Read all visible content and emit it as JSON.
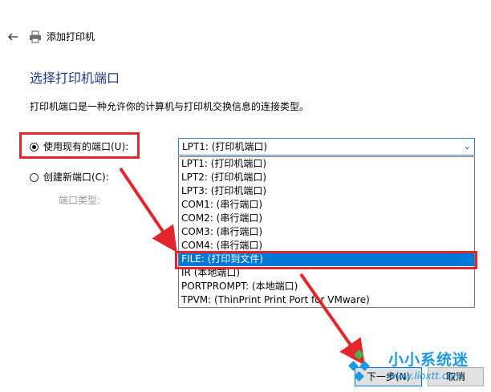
{
  "header": {
    "title": "添加打印机",
    "back_icon": "back-arrow-icon",
    "printer_icon": "printer-icon"
  },
  "page": {
    "heading": "选择打印机端口",
    "description": "打印机端口是一种允许你的计算机与打印机交换信息的连接类型。"
  },
  "port_choice": {
    "existing_label": "使用现有的端口(U):",
    "new_label": "创建新端口(C):",
    "port_type_label": "端口类型:"
  },
  "combo": {
    "selected_value": "LPT1: (打印机端口)"
  },
  "dropdown": {
    "options": [
      "LPT1: (打印机端口)",
      "LPT2: (打印机端口)",
      "LPT3: (打印机端口)",
      "COM1: (串行端口)",
      "COM2: (串行端口)",
      "COM3: (串行端口)",
      "COM4: (串行端口)",
      "FILE: (打印到文件)",
      "IR (本地端口)",
      "PORTPROMPT: (本地端口)",
      "TPVM: (ThinPrint Print Port for VMware)"
    ],
    "highlighted_index": 7
  },
  "buttons": {
    "next_label": "下一步(N)",
    "cancel_label": "取消"
  },
  "watermark": {
    "text": "小小系统迷",
    "url": "www.lioxtt.com"
  },
  "colors": {
    "accent": "#0078d7",
    "heading": "#1e3d87",
    "annotation_red": "#e3262d",
    "watermark_blue": "#1a9ae0"
  }
}
